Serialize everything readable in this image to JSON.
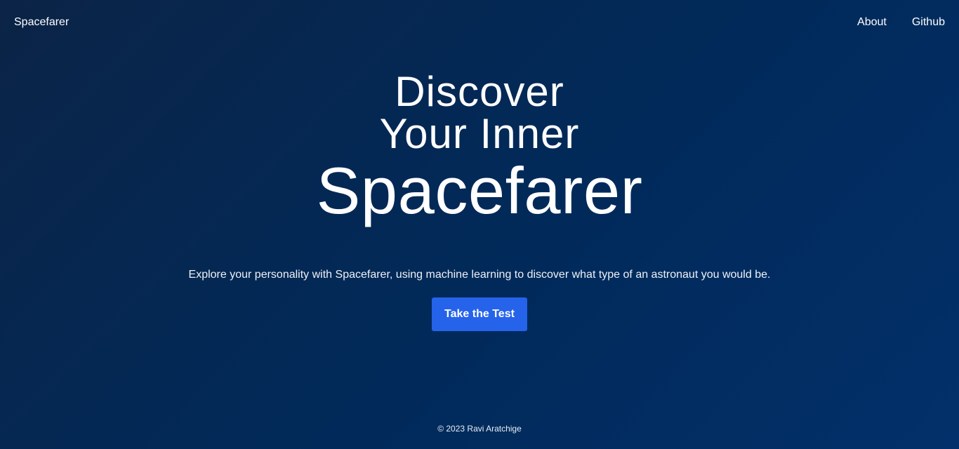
{
  "nav": {
    "brand": "Spacefarer",
    "links": [
      "About",
      "Github"
    ]
  },
  "hero": {
    "line1": "Discover",
    "line2": "Your Inner",
    "line3": "Spacefarer"
  },
  "tagline": "Explore your personality with Spacefarer, using machine learning to discover what type of an astronaut you would be.",
  "cta_label": "Take the Test",
  "footer": "© 2023 Ravi Aratchige",
  "colors": {
    "background": "#012a5a",
    "button": "#2563eb",
    "text": "#ffffff"
  }
}
